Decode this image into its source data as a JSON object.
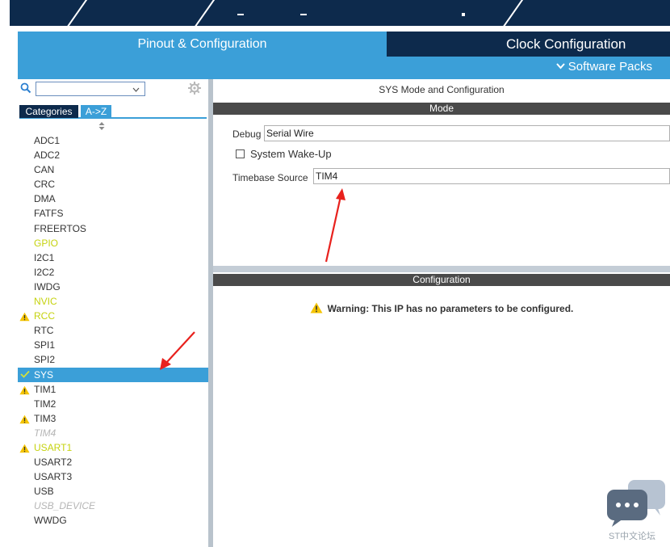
{
  "tabs": {
    "pinout": "Pinout & Configuration",
    "clock": "Clock Configuration",
    "software_packs": "Software Packs"
  },
  "left_panel": {
    "search": {
      "value": ""
    },
    "categories_tab": "Categories",
    "az_tab": "A->Z",
    "items": [
      {
        "label": "ADC1",
        "state": "normal",
        "icon": ""
      },
      {
        "label": "ADC2",
        "state": "normal",
        "icon": ""
      },
      {
        "label": "CAN",
        "state": "normal",
        "icon": ""
      },
      {
        "label": "CRC",
        "state": "normal",
        "icon": ""
      },
      {
        "label": "DMA",
        "state": "normal",
        "icon": ""
      },
      {
        "label": "FATFS",
        "state": "normal",
        "icon": ""
      },
      {
        "label": "FREERTOS",
        "state": "normal",
        "icon": ""
      },
      {
        "label": "GPIO",
        "state": "yellow",
        "icon": ""
      },
      {
        "label": "I2C1",
        "state": "normal",
        "icon": ""
      },
      {
        "label": "I2C2",
        "state": "normal",
        "icon": ""
      },
      {
        "label": "IWDG",
        "state": "normal",
        "icon": ""
      },
      {
        "label": "NVIC",
        "state": "yellow",
        "icon": ""
      },
      {
        "label": "RCC",
        "state": "yellow",
        "icon": "warning-icon"
      },
      {
        "label": "RTC",
        "state": "normal",
        "icon": ""
      },
      {
        "label": "SPI1",
        "state": "normal",
        "icon": ""
      },
      {
        "label": "SPI2",
        "state": "normal",
        "icon": ""
      },
      {
        "label": "SYS",
        "state": "selected",
        "icon": "check-icon"
      },
      {
        "label": "TIM1",
        "state": "normal",
        "icon": "warning-icon"
      },
      {
        "label": "TIM2",
        "state": "normal",
        "icon": ""
      },
      {
        "label": "TIM3",
        "state": "normal",
        "icon": "warning-icon"
      },
      {
        "label": "TIM4",
        "state": "disabled",
        "icon": ""
      },
      {
        "label": "USART1",
        "state": "yellow",
        "icon": "warning-icon"
      },
      {
        "label": "USART2",
        "state": "normal",
        "icon": ""
      },
      {
        "label": "USART3",
        "state": "normal",
        "icon": ""
      },
      {
        "label": "USB",
        "state": "normal",
        "icon": ""
      },
      {
        "label": "USB_DEVICE",
        "state": "disabled",
        "icon": ""
      },
      {
        "label": "WWDG",
        "state": "normal",
        "icon": ""
      }
    ]
  },
  "right_panel": {
    "title": "SYS Mode and Configuration",
    "mode_header": "Mode",
    "debug_label": "Debug",
    "debug_value": "Serial Wire",
    "wakeup_label": "System Wake-Up",
    "wakeup_checked": false,
    "timebase_label": "Timebase Source",
    "timebase_value": "TIM4",
    "config_header": "Configuration",
    "warning_text": "Warning: This IP has no parameters to be configured."
  },
  "watermark": {
    "text": "ST中文论坛"
  },
  "colors": {
    "dark_navy": "#0d2a4c",
    "accent_blue": "#3b9fd8",
    "header_grey": "#4a4a4a",
    "yellow_state": "#c5d20e",
    "warning_yellow": "#f5c400",
    "annotation_red": "#e8211d"
  }
}
